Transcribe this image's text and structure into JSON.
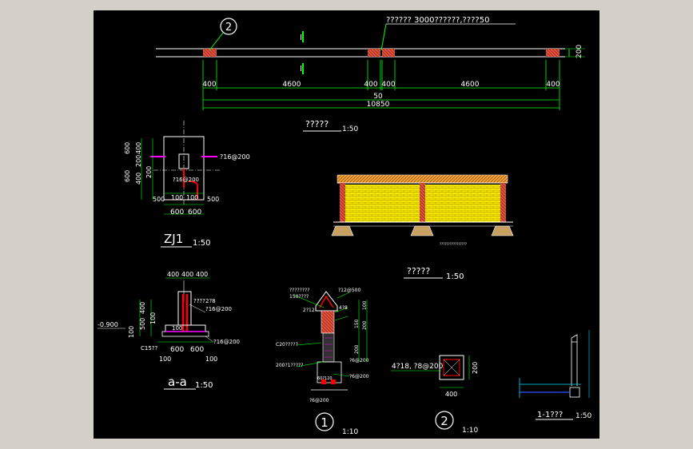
{
  "colors": {
    "viewport_bg": "#000000",
    "window_bg": "#d4d0c8",
    "line_white": "#ffffff",
    "line_green": "#00ff00",
    "magenta": "#ff00ff",
    "red": "#ff0000",
    "brick": "#c0392b",
    "wall_yellow": "#f2e600",
    "cap_orange": "#f0a030",
    "cyan": "#00d8ff",
    "blue": "#3050ff"
  },
  "plan": {
    "callout_2": "2",
    "top_note": "??????  3000??????,????50",
    "section_mark_top": "I",
    "section_mark_bottom": "I",
    "side_dim": "200",
    "dims_row1": [
      "400",
      "4600",
      "400",
      "400",
      "4600",
      "400"
    ],
    "dim_50": "50",
    "dim_total": "10850",
    "title": "?????",
    "scale": "1:50"
  },
  "elevation": {
    "note": "????????????????",
    "title": "?????",
    "scale": "1:50"
  },
  "zj1": {
    "left_dims": [
      "600",
      "400",
      "200",
      "200",
      "400",
      "600"
    ],
    "callout_right": "?16@200",
    "callout_inner": "?16@200",
    "bottom_dims_row1": [
      "500",
      "100",
      "100",
      "500"
    ],
    "bottom_dims_row2": [
      "600",
      "600"
    ],
    "title": "ZJ1",
    "scale": "1:50"
  },
  "section_aa": {
    "top_dims": [
      "400",
      "400",
      "400"
    ],
    "label_top": "????",
    "label_2": "2?8",
    "label_3": "?16@200",
    "level": "-0.900",
    "left_dims": [
      "400",
      "100",
      "500",
      "100"
    ],
    "label_c15": "C15??",
    "label_bottom_right": "?16@200",
    "bottom_dims": [
      "100",
      "600",
      "600",
      "100"
    ],
    "inner_100": "100",
    "title": "a-a",
    "scale": "1:50"
  },
  "detail1": {
    "labels": [
      "????????",
      "150????",
      "?12@500",
      "4?8",
      "2?12",
      "C20?????",
      "200?1?????",
      "?6@200",
      "60?120",
      "?6@200",
      "?6@200"
    ],
    "right_dims": [
      "100",
      "150",
      "200",
      "200"
    ],
    "title": "1",
    "scale": "1:10"
  },
  "detail2": {
    "label": "4?18, ?8@200",
    "dim_right": "200",
    "dim_bottom": "400",
    "title": "2",
    "scale": "1:10"
  },
  "section11": {
    "title": "1-1???",
    "scale": "1:50"
  }
}
